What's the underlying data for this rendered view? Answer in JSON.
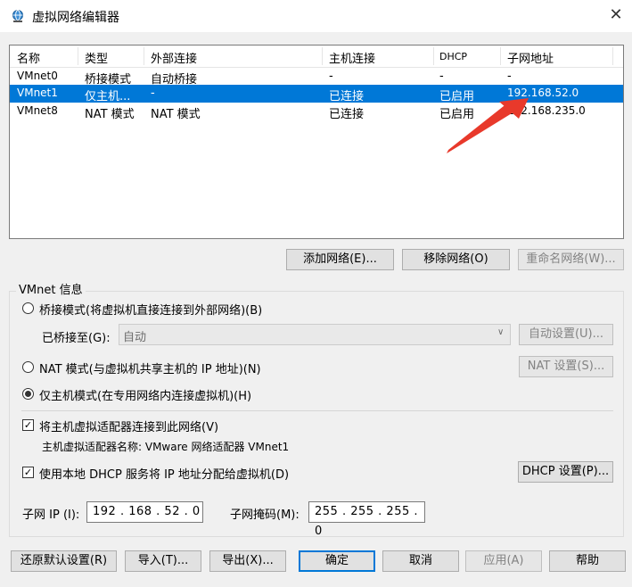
{
  "window": {
    "title": "虚拟网络编辑器",
    "icon": "network-globe-icon",
    "close_icon": "close-icon"
  },
  "table": {
    "columns": [
      "名称",
      "类型",
      "外部连接",
      "主机连接",
      "DHCP",
      "子网地址"
    ],
    "rows": [
      {
        "name": "VMnet0",
        "type": "桥接模式",
        "external": "自动桥接",
        "host": "-",
        "dhcp": "-",
        "subnet": "-",
        "selected": false
      },
      {
        "name": "VMnet1",
        "type": "仅主机...",
        "external": "-",
        "host": "已连接",
        "dhcp": "已启用",
        "subnet": "192.168.52.0",
        "selected": true
      },
      {
        "name": "VMnet8",
        "type": "NAT 模式",
        "external": "NAT 模式",
        "host": "已连接",
        "dhcp": "已启用",
        "subnet": "192.168.235.0",
        "selected": false
      }
    ]
  },
  "net_buttons": {
    "add": "添加网络(E)...",
    "remove": "移除网络(O)",
    "rename": "重命名网络(W)..."
  },
  "vmnet_info": {
    "group_label": "VMnet 信息",
    "bridged_label": "桥接模式(将虚拟机直接连接到外部网络)(B)",
    "bridged_to_label": "已桥接至(G):",
    "bridged_to_value": "自动",
    "auto_settings": "自动设置(U)...",
    "nat_label": "NAT 模式(与虚拟机共享主机的 IP 地址)(N)",
    "nat_settings": "NAT 设置(S)...",
    "hostonly_label": "仅主机模式(在专用网络内连接虚拟机)(H)",
    "connect_adapter_label": "将主机虚拟适配器连接到此网络(V)",
    "adapter_name_label": "主机虚拟适配器名称: VMware 网络适配器 VMnet1",
    "dhcp_label": "使用本地 DHCP 服务将 IP 地址分配给虚拟机(D)",
    "dhcp_settings": "DHCP 设置(P)...",
    "subnet_ip_label": "子网 IP (I):",
    "subnet_ip_value": "192 . 168 . 52 . 0",
    "subnet_mask_label": "子网掩码(M):",
    "subnet_mask_value": "255 . 255 . 255 . 0"
  },
  "footer": {
    "restore": "还原默认设置(R)",
    "import": "导入(T)...",
    "export": "导出(X)...",
    "ok": "确定",
    "cancel": "取消",
    "apply": "应用(A)",
    "help": "帮助"
  },
  "colors": {
    "selection": "#0078d7",
    "annotation_arrow": "#e8392b"
  }
}
